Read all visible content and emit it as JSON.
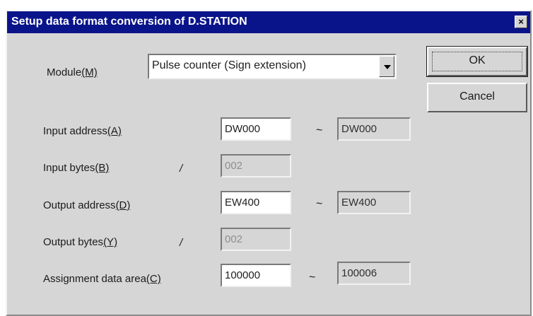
{
  "dialog": {
    "title": "Setup data format conversion of D.STATION",
    "close_glyph": "×"
  },
  "module": {
    "label": "Module",
    "mnemonic": "(M)",
    "value": "Pulse counter (Sign extension)"
  },
  "buttons": {
    "ok": "OK",
    "cancel": "Cancel"
  },
  "input_address": {
    "label": "Input address",
    "mnemonic": "(A)",
    "start": "DW000",
    "end": "DW000"
  },
  "input_bytes": {
    "label": "Input bytes",
    "mnemonic": "(B)",
    "value": "002"
  },
  "output_address": {
    "label": "Output address",
    "mnemonic": "(D)",
    "start": "EW400",
    "end": "EW400"
  },
  "output_bytes": {
    "label": "Output bytes",
    "mnemonic": "(Y)",
    "value": "002"
  },
  "assignment_area": {
    "label": "Assignment data area",
    "mnemonic": "(C)",
    "start": "100000",
    "end": "100006"
  },
  "separators": {
    "range": "~",
    "bytes": "/"
  }
}
